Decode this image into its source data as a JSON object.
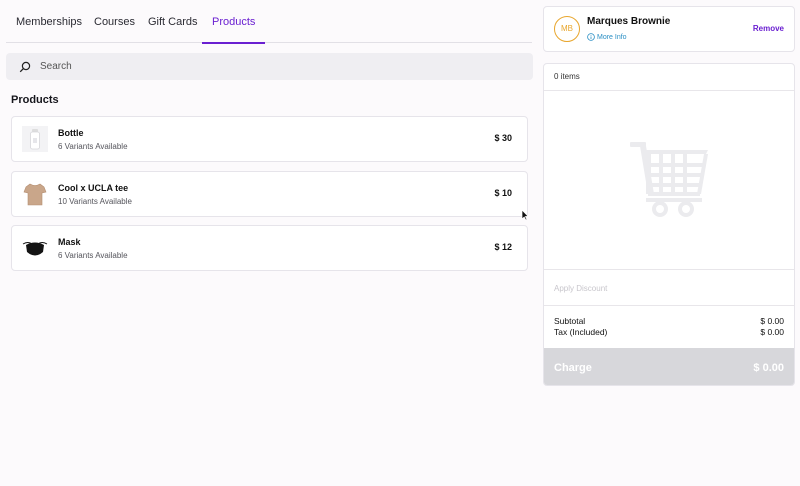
{
  "tabs": [
    {
      "label": "Memberships",
      "active": false
    },
    {
      "label": "Courses",
      "active": false
    },
    {
      "label": "Gift Cards",
      "active": false
    },
    {
      "label": "Products",
      "active": true
    }
  ],
  "search": {
    "placeholder": "Search",
    "value": "",
    "icon": "search-icon"
  },
  "section_title": "Products",
  "products": [
    {
      "name": "Bottle",
      "variants": "6 Variants Available",
      "price": "$ 30",
      "icon": "bottle-icon"
    },
    {
      "name": "Cool x UCLA tee",
      "variants": "10 Variants Available",
      "price": "$ 10",
      "icon": "tshirt-icon"
    },
    {
      "name": "Mask",
      "variants": "6 Variants Available",
      "price": "$ 12",
      "icon": "mask-icon"
    }
  ],
  "customer": {
    "initials": "MB",
    "name": "Marques Brownie",
    "more_info": "More Info",
    "remove": "Remove",
    "avatar_color": "#e8a62d"
  },
  "cart": {
    "count": "0 items",
    "empty_icon": "shopping-cart-icon",
    "apply_discount": "Apply Discount",
    "subtotal_label": "Subtotal",
    "subtotal_value": "$ 0.00",
    "tax_label": "Tax (Included)",
    "tax_value": "$ 0.00",
    "charge_label": "Charge",
    "charge_value": "$ 0.00"
  },
  "colors": {
    "accent": "#6a1fd1",
    "link": "#2a8fc4",
    "charge_disabled": "#d7d7db"
  }
}
